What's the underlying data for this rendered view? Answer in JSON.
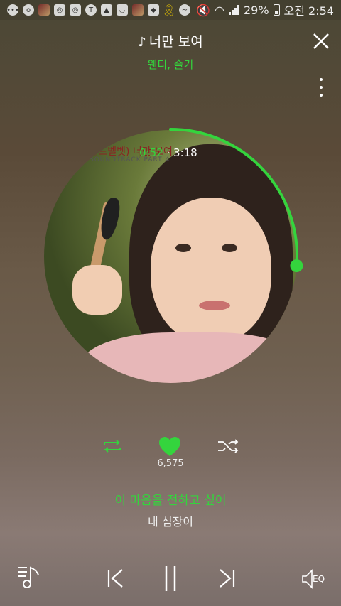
{
  "status_bar": {
    "battery": "29%",
    "time": "오전 2:54",
    "icons": [
      "chat-icon",
      "location-icon",
      "app-icon",
      "instagram-icon",
      "instagram-icon",
      "kakaotalk-icon",
      "gallery-icon",
      "bag-icon",
      "app-icon",
      "shield-icon",
      "ribbon-icon",
      "messenger-icon",
      "mute-icon",
      "wifi-icon",
      "signal-icon",
      "battery-icon"
    ]
  },
  "song": {
    "title": "너만 보여",
    "artist": "웬디, 슬기"
  },
  "album": {
    "text": "(레드벨벳) 너만 보여",
    "sub": "SOUNDTRACK  PART 4"
  },
  "playback": {
    "elapsed": "0:52",
    "separator": "·",
    "total": "3:18",
    "progress": 0.2626
  },
  "likes": "6,575",
  "lyrics": {
    "current": "이 마음을 전하고 싶어",
    "next": "내 심장이"
  },
  "controls": {
    "eq_label": "EQ"
  },
  "colors": {
    "accent": "#34d43d"
  }
}
